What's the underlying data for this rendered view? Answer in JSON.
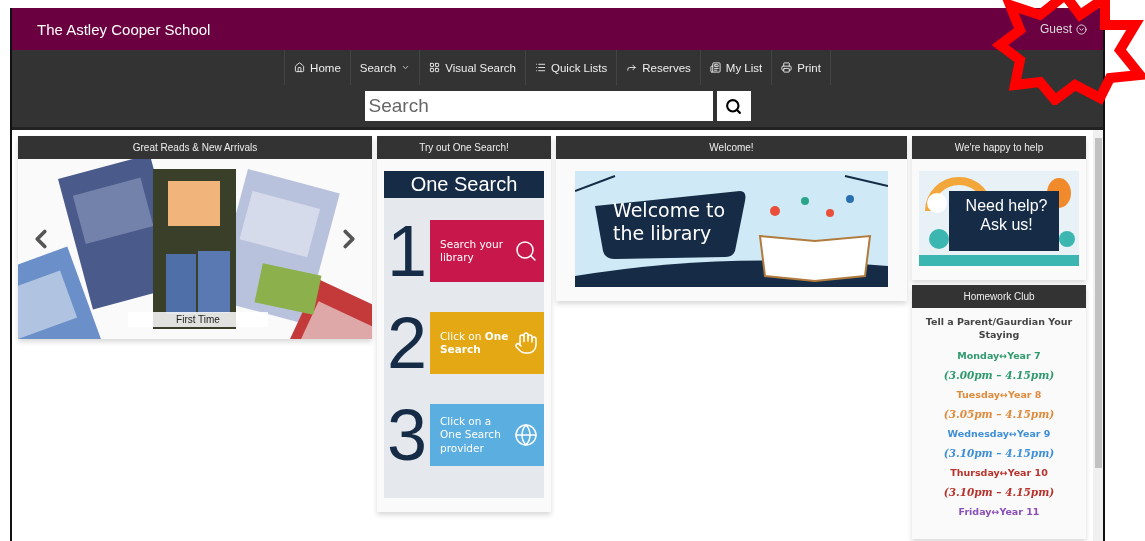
{
  "header": {
    "title": "The Astley Cooper School",
    "user": "Guest"
  },
  "nav": [
    {
      "label": "Home",
      "dropdown": false
    },
    {
      "label": "Search",
      "dropdown": true
    },
    {
      "label": "Visual Search",
      "dropdown": false
    },
    {
      "label": "Quick Lists",
      "dropdown": false
    },
    {
      "label": "Reserves",
      "dropdown": false
    },
    {
      "label": "My List",
      "dropdown": false
    },
    {
      "label": "Print",
      "dropdown": false
    }
  ],
  "search": {
    "placeholder": "Search"
  },
  "carousel": {
    "heading": "Great Reads & New Arrivals",
    "caption": "First Time"
  },
  "one_search": {
    "heading": "Try out One Search!",
    "title": "One Search",
    "steps": [
      {
        "number": "1",
        "text": "Search your library",
        "color": "#c8174a"
      },
      {
        "number": "2",
        "text": "Click on **One Search**",
        "color": "#e3a814"
      },
      {
        "number": "3",
        "text": "Click on a One Search provider",
        "color": "#5aaee0"
      }
    ]
  },
  "welcome": {
    "heading": "Welcome!",
    "banner": "Welcome to the library"
  },
  "help": {
    "heading": "We're happy to help",
    "banner": "Need help? Ask us!"
  },
  "homework": {
    "heading": "Homework Club",
    "intro": "Tell a Parent/Gaurdian Your Staying",
    "lines": [
      {
        "kind": "day",
        "text": "Monday↔Year 7",
        "color": "#2e9a6e"
      },
      {
        "kind": "time",
        "text": "(3.00pm – 4.15pm)",
        "color": "#2e9a6e"
      },
      {
        "kind": "day",
        "text": "Tuesday↔Year 8",
        "color": "#e08a3c"
      },
      {
        "kind": "time",
        "text": "(3.05pm – 4.15pm)",
        "color": "#e08a3c"
      },
      {
        "kind": "day",
        "text": "Wednesday↔Year 9",
        "color": "#3f8fd6"
      },
      {
        "kind": "time",
        "text": "(3.10pm – 4.15pm)",
        "color": "#3f8fd6"
      },
      {
        "kind": "day",
        "text": "Thursday↔Year 10",
        "color": "#b8322c"
      },
      {
        "kind": "time",
        "text": "(3.10pm – 4.15pm)",
        "color": "#b8322c"
      },
      {
        "kind": "day",
        "text": "Friday↔Year 11",
        "color": "#8a4fb8"
      }
    ]
  }
}
